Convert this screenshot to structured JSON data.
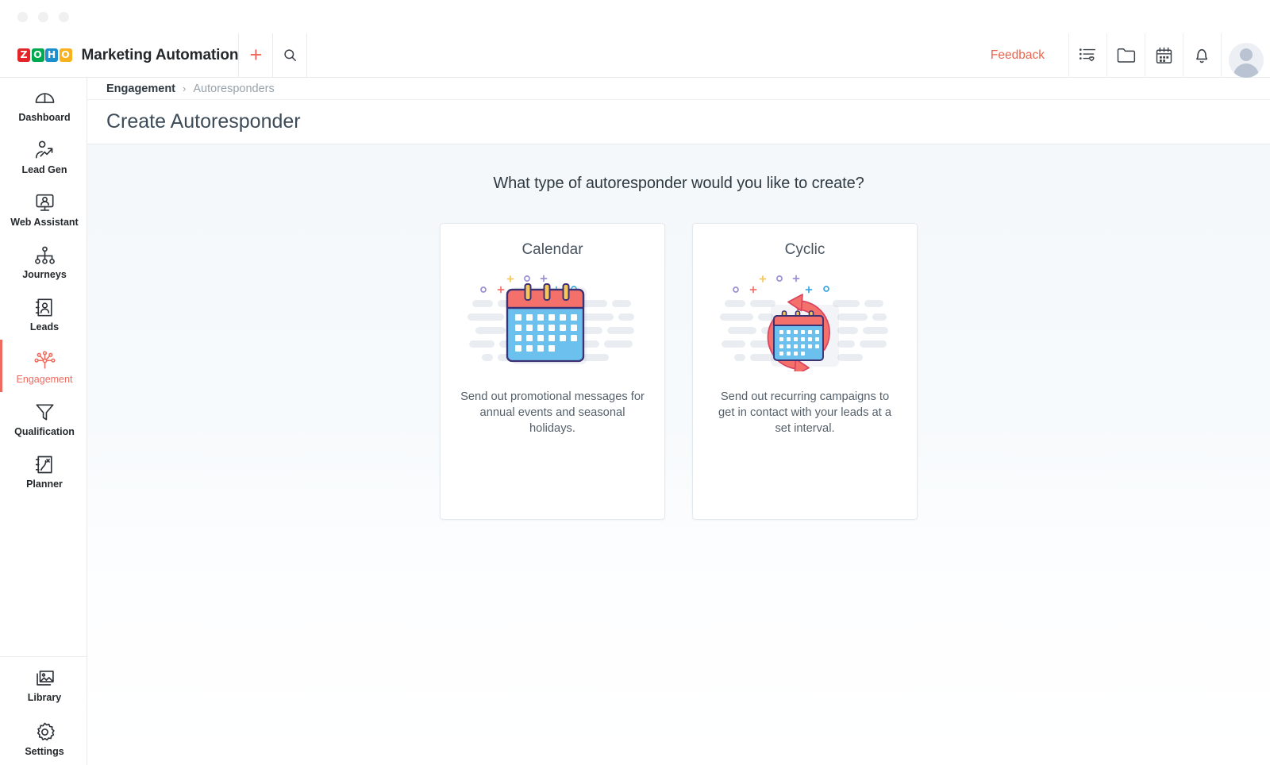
{
  "window": {
    "dots": [
      "close",
      "minimize",
      "maximize"
    ]
  },
  "topbar": {
    "logo_letters": [
      "Z",
      "O",
      "H",
      "O"
    ],
    "app_title": "Marketing Automation",
    "add_icon": "plus-icon",
    "search_icon": "search-icon",
    "feedback_label": "Feedback",
    "right_icons": [
      "list-favorites-icon",
      "folder-icon",
      "calendar-icon",
      "bell-icon"
    ],
    "avatar": "user-avatar"
  },
  "sidebar": {
    "items": [
      {
        "label": "Dashboard",
        "icon": "speedometer-icon",
        "active": false
      },
      {
        "label": "Lead Gen",
        "icon": "person-growth-icon",
        "active": false
      },
      {
        "label": "Web Assistant",
        "icon": "monitor-person-icon",
        "active": false
      },
      {
        "label": "Journeys",
        "icon": "hierarchy-icon",
        "active": false
      },
      {
        "label": "Leads",
        "icon": "contact-card-icon",
        "active": false
      },
      {
        "label": "Engagement",
        "icon": "network-nodes-icon",
        "active": true
      },
      {
        "label": "Qualification",
        "icon": "funnel-icon",
        "active": false
      },
      {
        "label": "Planner",
        "icon": "planner-book-icon",
        "active": false
      }
    ],
    "bottom_items": [
      {
        "label": "Library",
        "icon": "images-icon"
      },
      {
        "label": "Settings",
        "icon": "gear-icon"
      }
    ]
  },
  "breadcrumb": {
    "parent": "Engagement",
    "separator": "›",
    "current": "Autoresponders"
  },
  "page": {
    "title": "Create Autoresponder",
    "question": "What type of autoresponder would you like to create?"
  },
  "cards": [
    {
      "title": "Calendar",
      "description": "Send out promotional messages for annual events and seasonal holidays.",
      "illustration": "calendar-illustration"
    },
    {
      "title": "Cyclic",
      "description": "Send out recurring campaigns to get in contact with your leads at a set interval.",
      "illustration": "cyclic-calendar-illustration"
    }
  ],
  "colors": {
    "accent_red": "#ef6a5e",
    "feedback": "#e8664f",
    "calendar_header": "#f4706b",
    "calendar_body": "#6cc0ee",
    "calendar_outline": "#3b3274",
    "ring_yellow": "#f7c75a",
    "arrow_coral": "#f4706b",
    "placeholder_gray": "#e9edf1",
    "card_border": "#e3eaef",
    "content_bg_top": "#f4f8fb",
    "content_bg_bottom": "#ffffff"
  }
}
